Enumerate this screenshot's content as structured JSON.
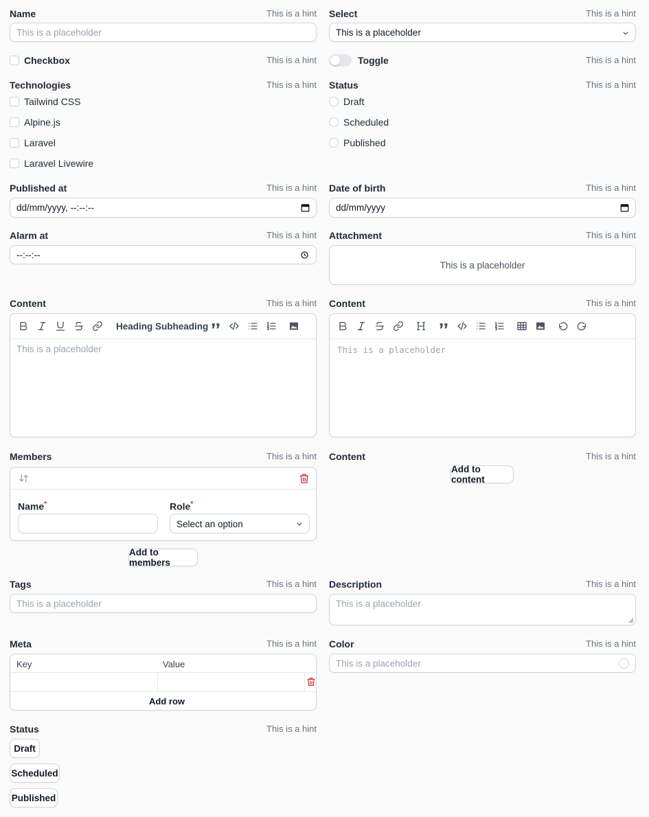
{
  "hint": "This is a hint",
  "placeholder": "This is a placeholder",
  "name_field": {
    "label": "Name"
  },
  "select_field": {
    "label": "Select",
    "value": "This is a placeholder"
  },
  "checkbox_field": {
    "label": "Checkbox"
  },
  "toggle_field": {
    "label": "Toggle"
  },
  "technologies": {
    "label": "Technologies",
    "options": [
      "Tailwind CSS",
      "Alpine.js",
      "Laravel",
      "Laravel Livewire"
    ]
  },
  "status_radio": {
    "label": "Status",
    "options": [
      "Draft",
      "Scheduled",
      "Published"
    ]
  },
  "published_at": {
    "label": "Published at",
    "value": "dd/mm/yyyy, --:--:--"
  },
  "date_of_birth": {
    "label": "Date of birth",
    "value": "dd/mm/yyyy"
  },
  "alarm_at": {
    "label": "Alarm at",
    "value": "--:--:--"
  },
  "attachment": {
    "label": "Attachment",
    "text": "This is a placeholder"
  },
  "rich_editor": {
    "label": "Content",
    "heading": "Heading",
    "subheading": "Subheading",
    "placeholder": "This is a placeholder"
  },
  "markdown_editor": {
    "label": "Content",
    "placeholder": "This is a placeholder"
  },
  "members": {
    "label": "Members",
    "name_label": "Name",
    "role_label": "Role",
    "required_mark": "*",
    "role_value": "Select an option",
    "add_button": "Add to members"
  },
  "builder": {
    "label": "Content",
    "add_button": "Add to content"
  },
  "tags": {
    "label": "Tags",
    "placeholder": "This is a placeholder"
  },
  "description": {
    "label": "Description",
    "placeholder": "This is a placeholder"
  },
  "meta": {
    "label": "Meta",
    "key_header": "Key",
    "value_header": "Value",
    "add_row": "Add row"
  },
  "color": {
    "label": "Color",
    "placeholder": "This is a placeholder"
  },
  "status_buttons": {
    "label": "Status",
    "options": [
      "Draft",
      "Scheduled",
      "Published"
    ]
  },
  "colors": {
    "danger": "#dc2626",
    "border": "#d1d5db",
    "hint": "#6b7280",
    "placeholder": "#9ca3af"
  }
}
